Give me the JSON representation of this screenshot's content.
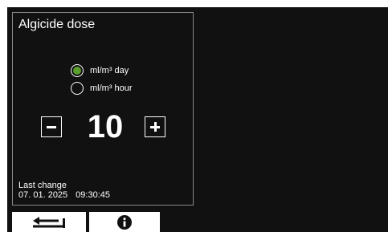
{
  "panel": {
    "title": "Algicide dose",
    "options": [
      {
        "label": "ml/m³ day",
        "selected": true
      },
      {
        "label": "ml/m³ hour",
        "selected": false
      }
    ],
    "value": "10",
    "last_change_label": "Last change",
    "last_change_date": "07. 01. 2025",
    "last_change_time": "09:30:45"
  },
  "icons": {
    "minus": "minus-icon",
    "plus": "plus-icon",
    "back": "back-arrow-icon",
    "info": "info-icon"
  },
  "colors": {
    "background": "#111111",
    "accent": "#5a9e2d",
    "border": "#8a8a8a"
  }
}
